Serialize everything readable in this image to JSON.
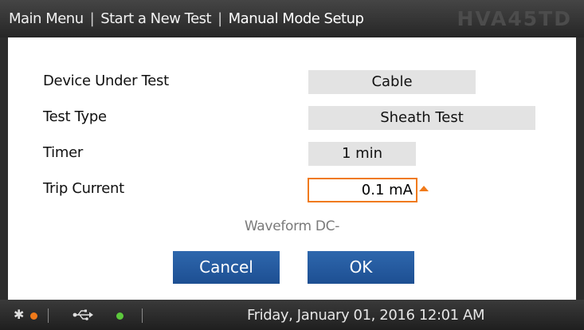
{
  "header": {
    "breadcrumbs": [
      "Main Menu",
      "Start a New Test",
      "Manual Mode Setup"
    ],
    "separator": "|",
    "brand": "HVA45TD"
  },
  "form": {
    "rows": [
      {
        "label": "Device Under Test",
        "value": "Cable"
      },
      {
        "label": "Test Type",
        "value": "Sheath Test"
      },
      {
        "label": "Timer",
        "value": "1 min"
      },
      {
        "label": "Trip Current",
        "value": "0.1 mA"
      }
    ],
    "waveform": "Waveform DC-"
  },
  "buttons": {
    "cancel": "Cancel",
    "ok": "OK"
  },
  "status": {
    "datetime": "Friday, January 01, 2016 12:01 AM",
    "bluetooth_icon": "bluetooth-icon",
    "usb_icon": "usb-icon",
    "bluetooth_status_color": "#f07a1a",
    "usb_status_color": "#5cc83c"
  },
  "colors": {
    "accent": "#f07a1a",
    "button": "#2a5fa5"
  }
}
